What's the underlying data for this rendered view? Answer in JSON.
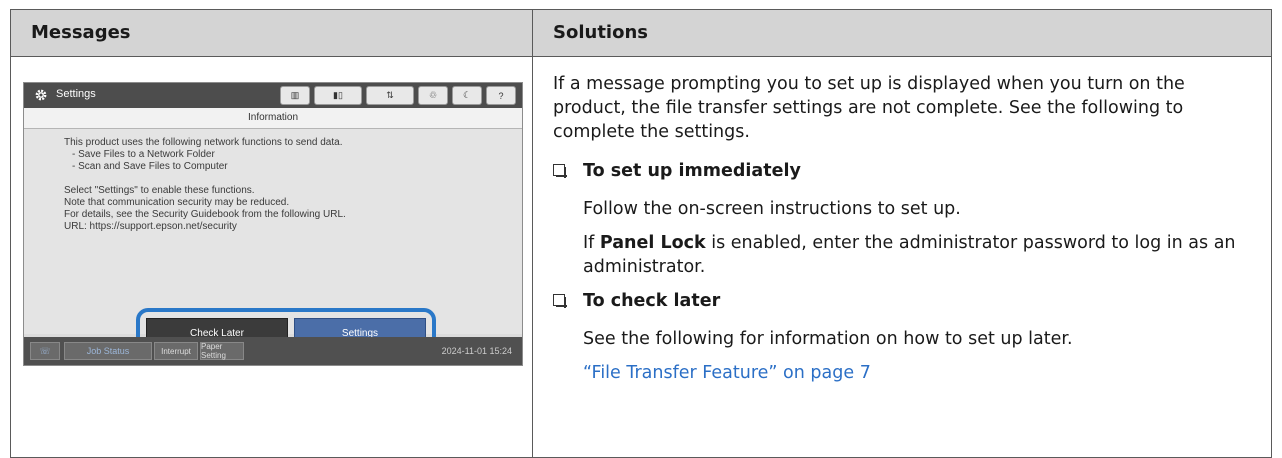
{
  "table": {
    "header_messages": "Messages",
    "header_solutions": "Solutions"
  },
  "screen": {
    "title": "Settings",
    "info_title": "Information",
    "body_lines": [
      "This product uses the following network functions to send data.",
      "- Save Files to a Network Folder",
      "- Scan and Save Files to Computer",
      "Select \"Settings\" to enable these functions.",
      "Note that communication security may be reduced.",
      "For details, see the Security Guidebook from the following URL.",
      "URL: https://support.epson.net/security"
    ],
    "btn_check_later": "Check Later",
    "btn_settings": "Settings",
    "bottom": {
      "job_status": "Job Status",
      "interrupt": "Interrupt",
      "paper_setting": "Paper Setting",
      "datetime": "2024-11-01 15:24"
    },
    "top_icons": [
      "printer-status-icon",
      "ink-icon",
      "paper-icon",
      "network-icon",
      "eco-icon",
      "sleep-icon",
      "help-icon"
    ]
  },
  "solutions": {
    "intro": "If a message prompting you to set up is displayed when you turn on the product, the file transfer settings are not complete. See the following to complete the settings.",
    "item1_title": "To set up immediately",
    "item1_text1": "Follow the on-screen instructions to set up.",
    "item1_text2_pre": "If ",
    "item1_text2_bold": "Panel Lock",
    "item1_text2_post": " is enabled, enter the administrator password to log in as an administrator.",
    "item2_title": "To check later",
    "item2_text": "See the following for information on how to set up later.",
    "link": "“File Transfer Feature” on page 7"
  },
  "colors": {
    "header_bg": "#d4d4d4",
    "link": "#2b6fc6",
    "highlight": "#2a78c8",
    "settings_button": "#4b6ea8"
  }
}
